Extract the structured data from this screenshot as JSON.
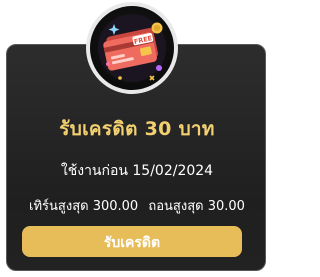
{
  "promo": {
    "title": "รับเครดิต 30 บาท",
    "expire_text": "ใช้งานก่อน 15/02/2024",
    "max_deposit": "เทิร์นสูงสุด 300.00",
    "max_withdraw": "ถอนสูงสุด 30.00",
    "claim_label": "รับเครดิต",
    "card_badge": "FREE"
  },
  "colors": {
    "accent": "#e7bd5a",
    "title": "#f3d070",
    "card_bg": "#262626",
    "card_border": "#5a5a5a",
    "credit_card": "#e8584f"
  },
  "icons": [
    "credit-card-icon",
    "sparkle-icon",
    "coin-icon"
  ]
}
